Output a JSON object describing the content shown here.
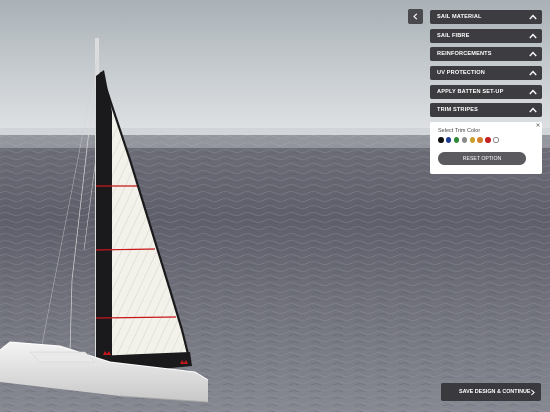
{
  "accordion": [
    {
      "label": "SAIL MATERIAL"
    },
    {
      "label": "SAIL FIBRE"
    },
    {
      "label": "REINFORCEMENTS"
    },
    {
      "label": "UV PROTECTION"
    },
    {
      "label": "APPLY BATTEN SET-UP"
    },
    {
      "label": "TRIM STRIPES"
    }
  ],
  "trim": {
    "label": "Select Trim Color",
    "colors": [
      "#111111",
      "#1f3d91",
      "#2e8b3a",
      "#8a8a8a",
      "#c8a02a",
      "#d0812e",
      "#c42121",
      "#ffffff"
    ],
    "reset_label": "RESET OPTION"
  },
  "footer": {
    "save_label": "SAVE DESIGN & CONTINUE"
  },
  "colors": {
    "panel_bg": "#3d3d41",
    "stripe": "#c8161b"
  }
}
